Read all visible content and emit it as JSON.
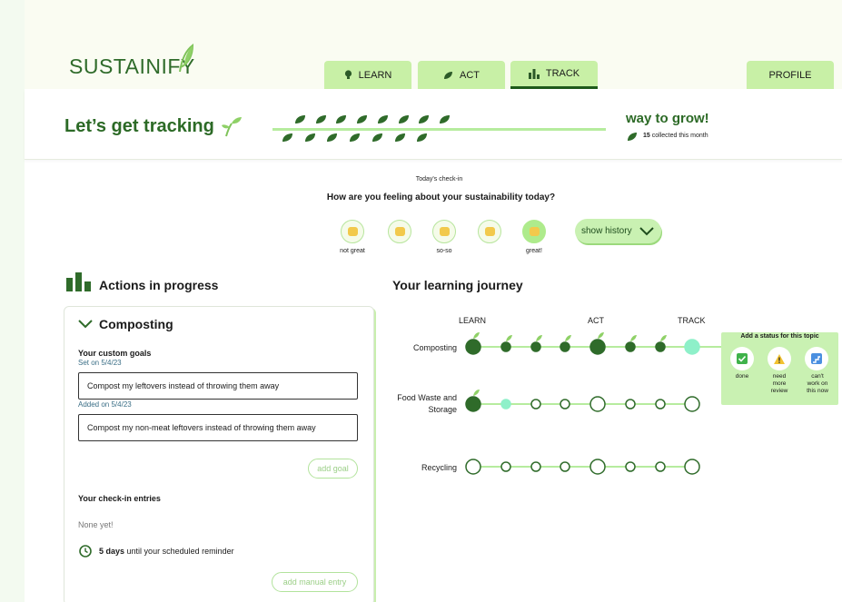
{
  "app": {
    "logo_text": "SUSTAINIFY"
  },
  "nav": {
    "tabs": [
      {
        "label": "LEARN",
        "icon": "lightbulb-icon"
      },
      {
        "label": "ACT",
        "icon": "leaf-icon"
      },
      {
        "label": "TRACK",
        "icon": "bar-chart-icon",
        "active": true
      }
    ],
    "profile_label": "PROFILE"
  },
  "banner": {
    "title": "Let’s get tracking",
    "grow_title": "way to grow!",
    "collected_count": "15",
    "collected_suffix": "collected this month"
  },
  "checkin": {
    "label": "Today's check-in",
    "question": "How are you feeling about your sustainability today?",
    "moods": [
      {
        "label": "not great"
      },
      {
        "label": ""
      },
      {
        "label": "so-so"
      },
      {
        "label": ""
      },
      {
        "label": "great!",
        "selected": true
      }
    ],
    "history_button": "show history"
  },
  "actions": {
    "section_title": "Actions in progress",
    "card": {
      "title": "Composting",
      "goals_heading": "Your custom goals",
      "goals": [
        {
          "note": "Set on 5/4/23",
          "text": "Compost my leftovers instead of throwing them away"
        },
        {
          "note": "Added on 5/4/23",
          "text": "Compost my non-meat leftovers instead of throwing them away"
        }
      ],
      "add_goal_button": "add goal",
      "entries_heading": "Your check-in entries",
      "entries_empty": "None yet!",
      "reminder_bold": "5 days",
      "reminder_rest": "until your scheduled reminder",
      "add_entry_button": "add manual entry"
    }
  },
  "journey": {
    "section_title": "Your learning journey",
    "stages": [
      "LEARN",
      "ACT",
      "TRACK"
    ],
    "topics": [
      {
        "label": "Composting",
        "completed_nodes": 7,
        "current_node": 8
      },
      {
        "label": "Food Waste and Storage",
        "completed_nodes": 1,
        "current_node": 2
      },
      {
        "label": "Recycling",
        "completed_nodes": 0,
        "current_node": 0
      }
    ],
    "status_popup": {
      "title": "Add a status for this topic",
      "options": [
        {
          "label": "done",
          "icon": "check-icon"
        },
        {
          "label": "need more review",
          "icon": "warning-icon"
        },
        {
          "label": "can't work on this now",
          "icon": "stairs-icon"
        }
      ]
    }
  },
  "colors": {
    "brand_dark": "#2c6a26",
    "tab_green": "#c8f0a6",
    "node_dark": "#2f6b2a",
    "node_current": "#8ef0c9",
    "track_line": "#b6ec9e"
  }
}
